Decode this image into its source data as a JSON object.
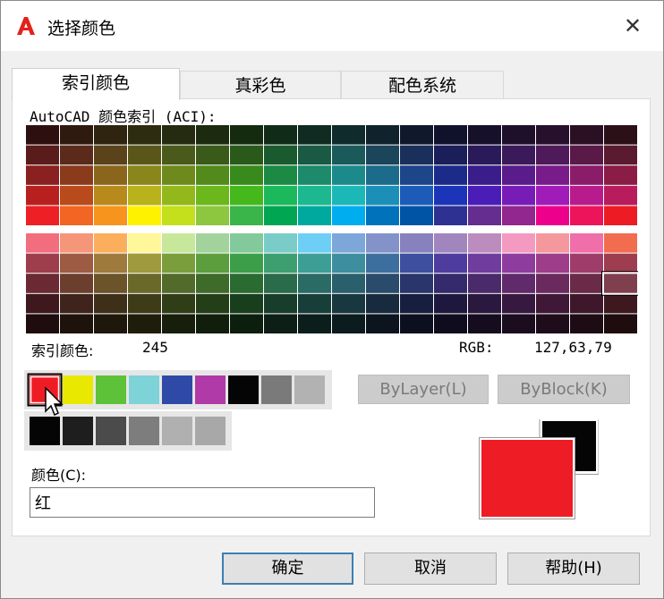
{
  "window": {
    "title": "选择颜色",
    "close_glyph": "✕",
    "logo_letter": "A",
    "logo_color": "#e2231a"
  },
  "tabs": [
    {
      "label": "索引颜色",
      "active": true
    },
    {
      "label": "真彩色",
      "active": false
    },
    {
      "label": "配色系统",
      "active": false
    }
  ],
  "aci": {
    "group_label": "AutoCAD 颜色索引 (ACI):",
    "index_label": "索引颜色:",
    "index_value": "245",
    "rgb_label": "RGB:",
    "rgb_value": "127,63,79",
    "upper_rows": [
      [
        "#2e0f0f",
        "#2f1a10",
        "#2e2410",
        "#2d2b10",
        "#252b10",
        "#1c2b10",
        "#142b10",
        "#102b18",
        "#102b22",
        "#102b2b",
        "#10222b",
        "#10182b",
        "#10112b",
        "#16102b",
        "#1e102b",
        "#27102b",
        "#2b1024",
        "#2b1018"
      ],
      [
        "#5a1b1b",
        "#5a2a1a",
        "#5a421a",
        "#5a561a",
        "#4a5a1a",
        "#3a5a1a",
        "#295a1a",
        "#1a5a2f",
        "#1a5a45",
        "#1a5a5a",
        "#1a455a",
        "#1a305a",
        "#1a1f5a",
        "#2a1a5a",
        "#3b1a5a",
        "#4e1a5a",
        "#5a1a47",
        "#5a1a30"
      ],
      [
        "#8a2020",
        "#8a3b1c",
        "#8a661c",
        "#8a861c",
        "#6f8a1c",
        "#528a1c",
        "#388a1c",
        "#1c8a45",
        "#1c8a6b",
        "#1c8a8a",
        "#1c6b8a",
        "#1c458a",
        "#1c2b8a",
        "#3a1c8a",
        "#5a1c8a",
        "#781c8a",
        "#8a1c6a",
        "#8a1c45"
      ],
      [
        "#b82020",
        "#b84a1c",
        "#b88a1c",
        "#b8b21c",
        "#92b81c",
        "#6cb81c",
        "#45b81c",
        "#1cb85c",
        "#1cb88f",
        "#1cb8b8",
        "#1c8fb8",
        "#1c5cb8",
        "#1c35b8",
        "#4a1cb8",
        "#781cb8",
        "#a01cb8",
        "#b81c8c",
        "#b81c5c"
      ],
      [
        "#ee2026",
        "#f26522",
        "#f7941d",
        "#fff200",
        "#c4df1b",
        "#8dc63f",
        "#39b54a",
        "#00a651",
        "#00a99d",
        "#00aeef",
        "#0072bc",
        "#0054a6",
        "#2e3192",
        "#662d91",
        "#92278f",
        "#ec008c",
        "#ed145b",
        "#ed1c24"
      ]
    ],
    "lower_rows": [
      [
        "#f26d7d",
        "#f69679",
        "#fbaf5d",
        "#fff799",
        "#c7e89b",
        "#a3d39c",
        "#82ca9c",
        "#7accc8",
        "#6dcff6",
        "#7da7d9",
        "#8393ca",
        "#8781bd",
        "#a186be",
        "#bd8cbf",
        "#f49ac1",
        "#f5989d",
        "#f06eaa",
        "#f26c4f"
      ],
      [
        "#9e3d4b",
        "#9e5b44",
        "#9e7a3d",
        "#9e9a3d",
        "#7b9e3d",
        "#5c9e3d",
        "#3d9e4a",
        "#3d9e6f",
        "#3d9e95",
        "#3d8e9e",
        "#3d6f9e",
        "#3d4f9e",
        "#4f3d9e",
        "#6f3d9e",
        "#8e3d9e",
        "#9e3d8a",
        "#9e3d6a",
        "#9e3d4f"
      ],
      [
        "#6b2a33",
        "#6b3e2e",
        "#6b532a",
        "#6b692a",
        "#536b2a",
        "#3e6b2a",
        "#2a6b32",
        "#2a6b4b",
        "#2a6b65",
        "#2a606b",
        "#2a4b6b",
        "#2a356b",
        "#352a6b",
        "#4b2a6b",
        "#602a6b",
        "#6b2a5e",
        "#6b2a48",
        "#7f3f4f"
      ],
      [
        "#3e181d",
        "#3e241a",
        "#3e3018",
        "#3e3c18",
        "#303e18",
        "#243e18",
        "#183e1d",
        "#183e2b",
        "#183e3a",
        "#18373e",
        "#182b3e",
        "#181f3e",
        "#1f183e",
        "#2b183e",
        "#37183e",
        "#3e1836",
        "#3e182a",
        "#3e181f"
      ],
      [
        "#1e0c0e",
        "#1e120c",
        "#1e180c",
        "#1e1d0c",
        "#181e0c",
        "#121e0c",
        "#0c1e0e",
        "#0c1e15",
        "#0c1e1c",
        "#0c1b1e",
        "#0c151e",
        "#0c0f1e",
        "#0f0c1e",
        "#150c1e",
        "#1b0c1e",
        "#1e0c1b",
        "#1e0c15",
        "#1e0c0f"
      ]
    ]
  },
  "standard_colors": [
    "#ee1c24",
    "#e8e800",
    "#5dc239",
    "#7dd3d8",
    "#2f4aa6",
    "#b03aa8",
    "#050505",
    "#7a7a7a",
    "#b2b2b2"
  ],
  "gray_colors": [
    "#050505",
    "#1e1e1e",
    "#4b4b4b",
    "#7d7d7d",
    "#b0b0b0",
    "#a8a8a8"
  ],
  "buttons": {
    "bylayer": "ByLayer(L)",
    "byblock": "ByBlock(K)",
    "ok": "确定",
    "cancel": "取消",
    "help": "帮助(H)"
  },
  "color_field": {
    "label": "颜色(C):",
    "value": "红"
  },
  "preview": {
    "new_color": "#ee1c24",
    "old_color": "#050505"
  }
}
